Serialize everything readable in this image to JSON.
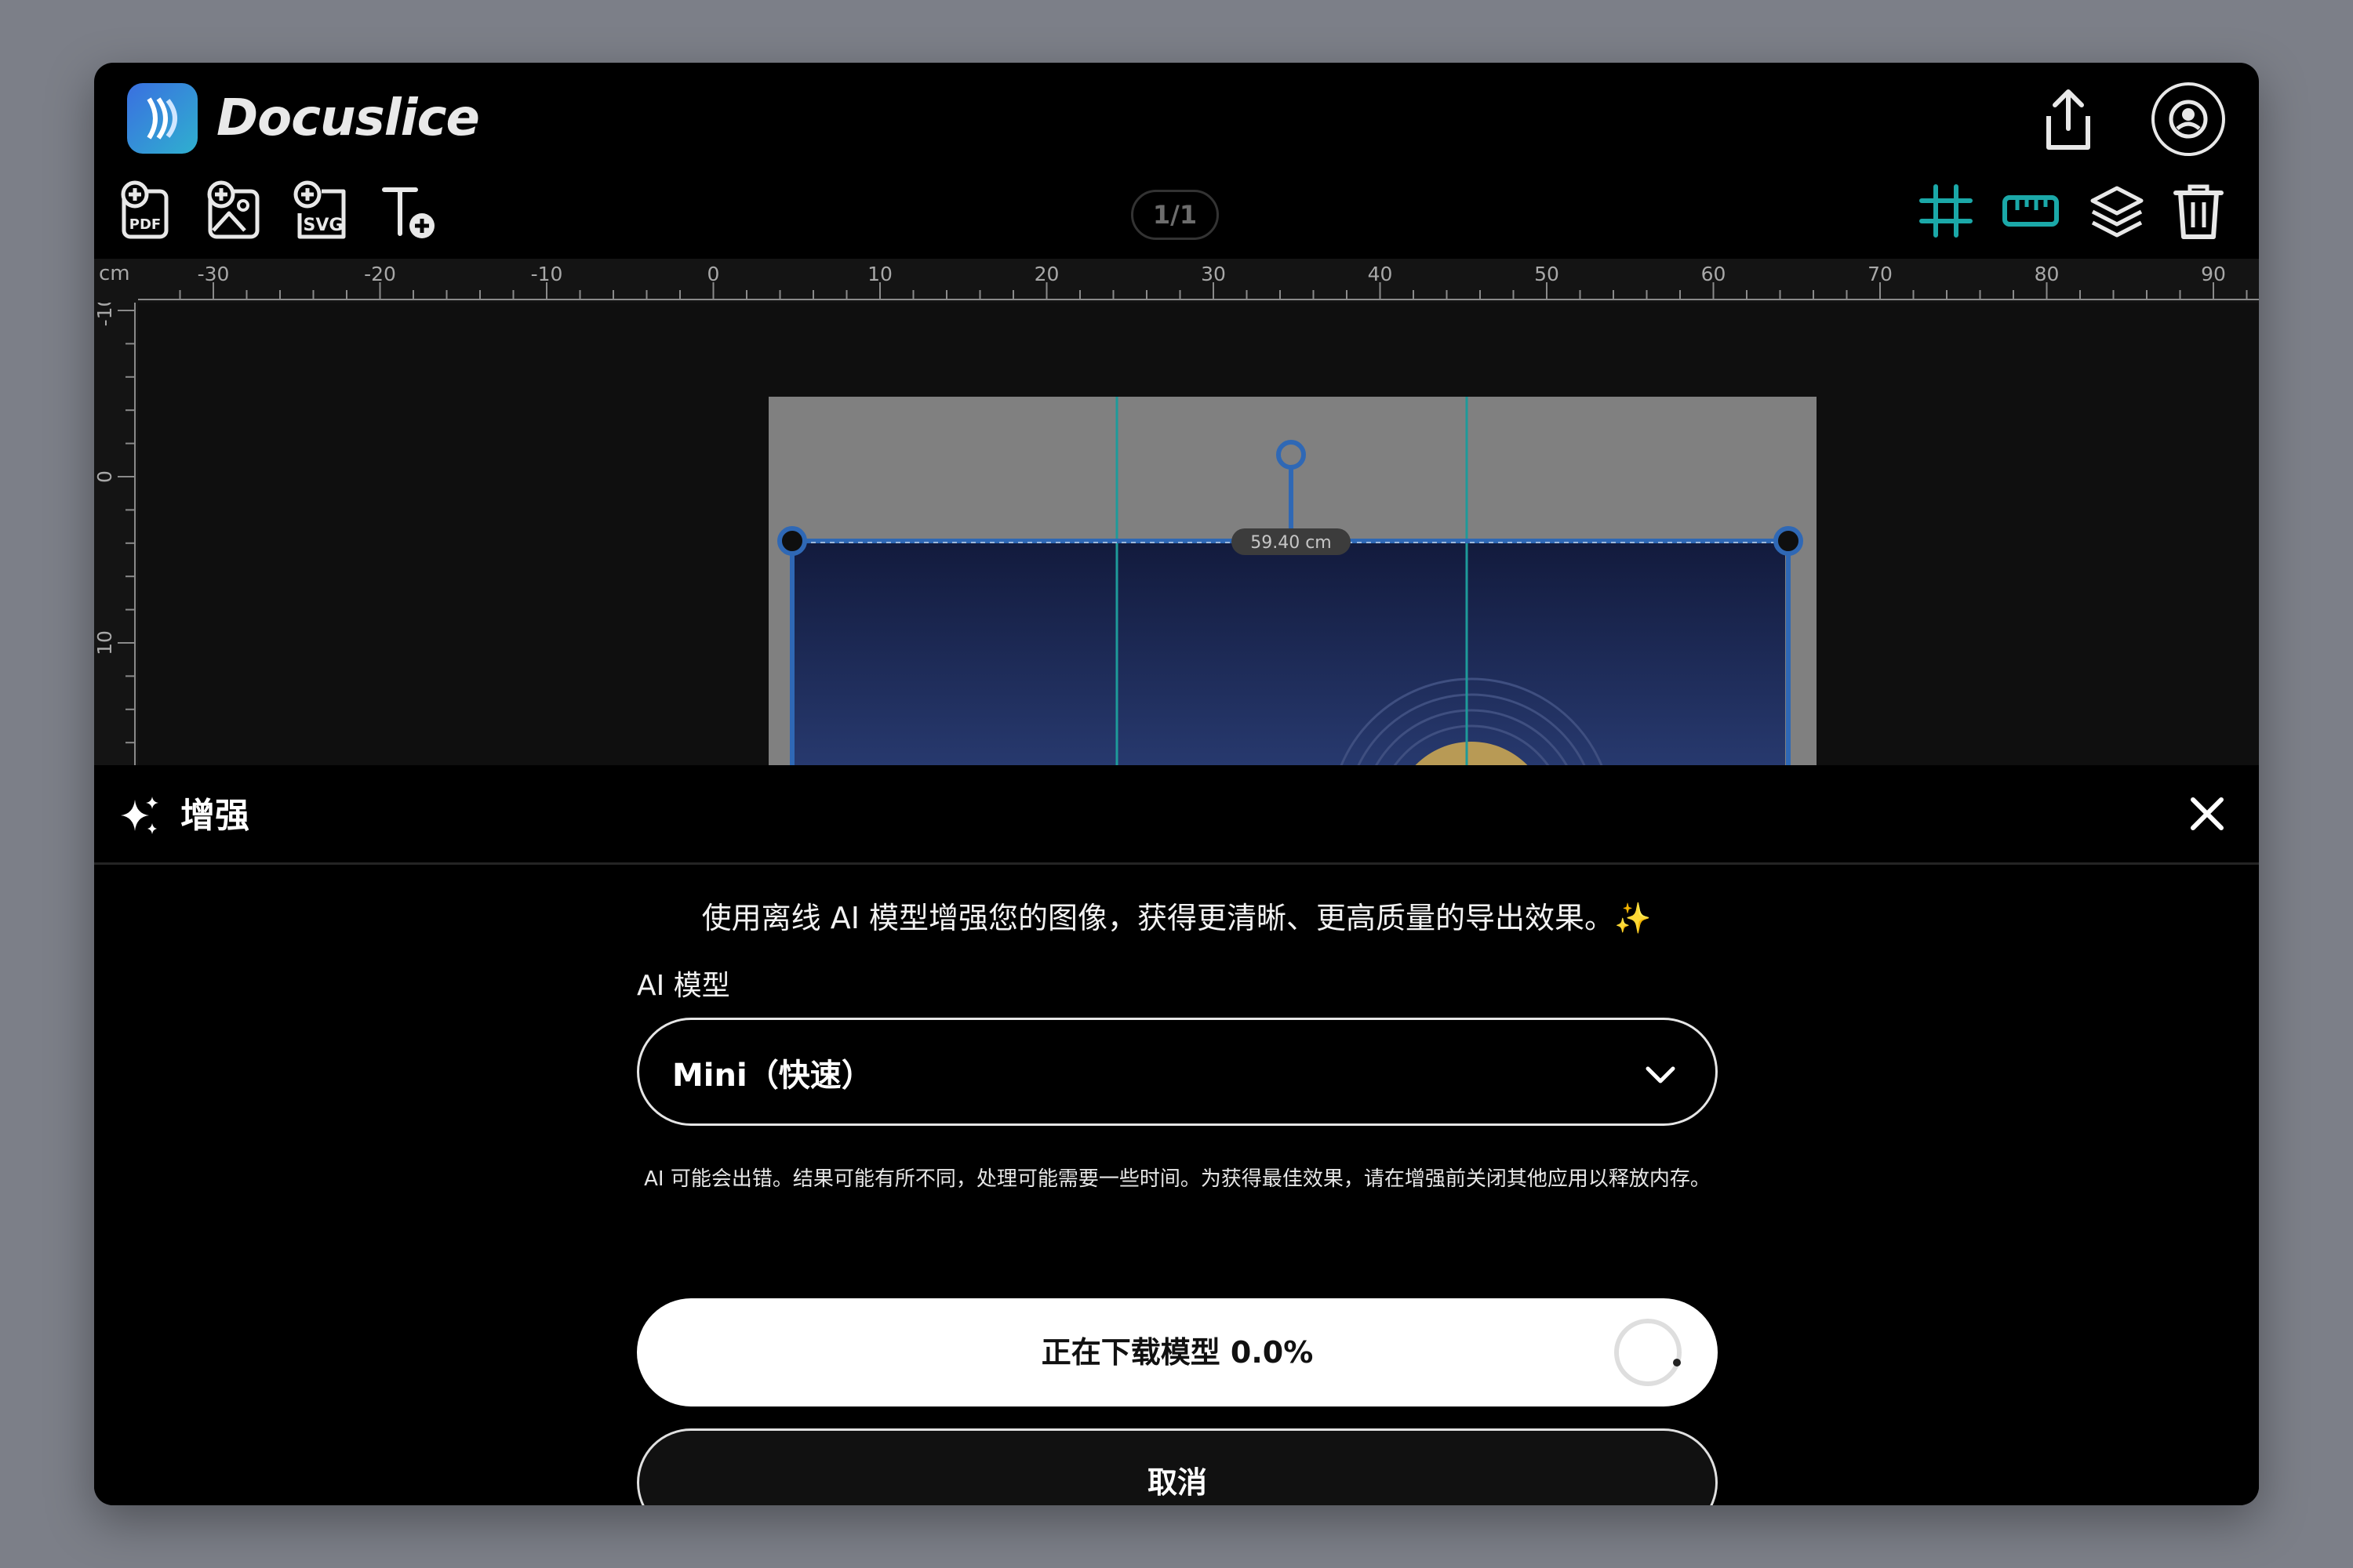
{
  "app": {
    "name": "Docuslice",
    "brand_colors": [
      "#3a6fe0",
      "#2fb0cf"
    ]
  },
  "header": {
    "icons": [
      "share-icon",
      "account-icon"
    ]
  },
  "toolbar": {
    "left_tools": [
      "add-pdf-icon",
      "add-image-icon",
      "add-svg-icon",
      "add-text-icon"
    ],
    "add_pdf_glyph": "PDF",
    "add_svg_glyph": "SVG",
    "page_indicator": "1/1",
    "right_tools": [
      "grid-icon",
      "ruler-icon",
      "layers-icon",
      "trash-icon"
    ],
    "active_color": "#1ba8a8"
  },
  "ruler": {
    "unit": "cm",
    "horizontal_ticks": [
      "-30",
      "-20",
      "-10",
      "0",
      "10",
      "20",
      "30",
      "40",
      "50",
      "60",
      "70",
      "80",
      "90"
    ],
    "vertical_ticks": [
      "-10",
      "0",
      "10"
    ]
  },
  "canvas": {
    "selection_width_label": "59.40 cm",
    "selection_color": "#2f68b5",
    "guide_color": "#1e9a9a"
  },
  "enhance_panel": {
    "title": "增强",
    "intro": "使用离线 AI 模型增强您的图像，获得更清晰、更高质量的导出效果。✨",
    "model_label": "AI 模型",
    "model_selected": "Mini（快速）",
    "disclaimer": "AI 可能会出错。结果可能有所不同，处理可能需要一些时间。为获得最佳效果，请在增强前关闭其他应用以释放内存。",
    "download_label": "正在下载模型 0.0%",
    "download_progress": 0.0,
    "cancel_label": "取消"
  }
}
